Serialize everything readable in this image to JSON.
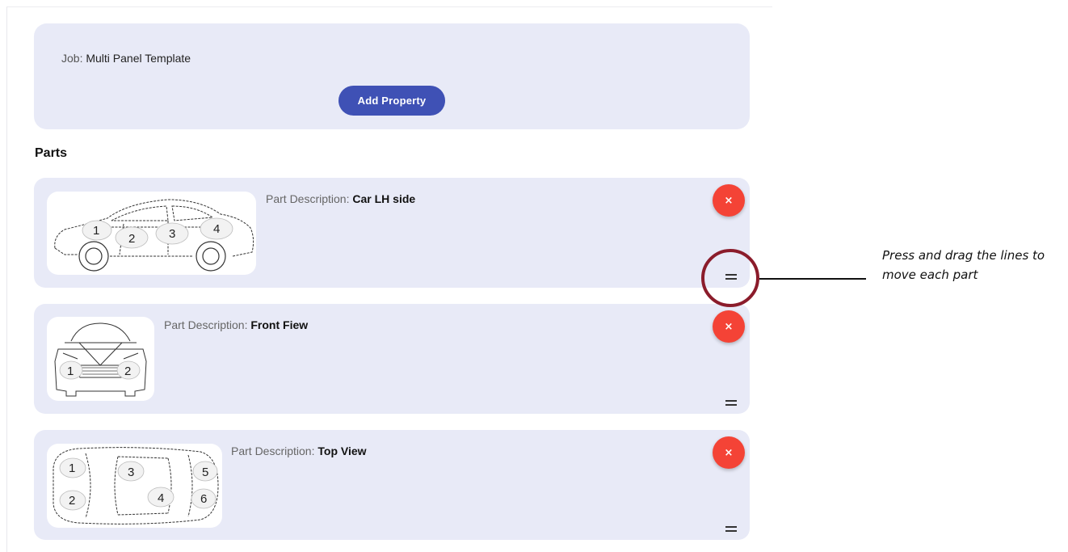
{
  "job": {
    "label": "Job: ",
    "value": "Multi Panel Template",
    "add_button_label": "Add Property"
  },
  "parts_heading": "Parts",
  "parts": [
    {
      "desc_label": "Part Description: ",
      "desc_value": "Car LH side",
      "delete_label": "×",
      "zones": [
        "1",
        "2",
        "3",
        "4"
      ]
    },
    {
      "desc_label": "Part Description: ",
      "desc_value": "Front Fiew",
      "delete_label": "×",
      "zones": [
        "1",
        "2"
      ]
    },
    {
      "desc_label": "Part Description: ",
      "desc_value": "Top View",
      "delete_label": "×",
      "zones": [
        "1",
        "2",
        "3",
        "4",
        "5",
        "6"
      ]
    }
  ],
  "callout": {
    "text": "Press and drag the lines to move each part"
  },
  "colors": {
    "card_bg": "#e8eaf7",
    "primary": "#3f51b5",
    "delete": "#f44336",
    "highlight": "#8b1c2b"
  }
}
